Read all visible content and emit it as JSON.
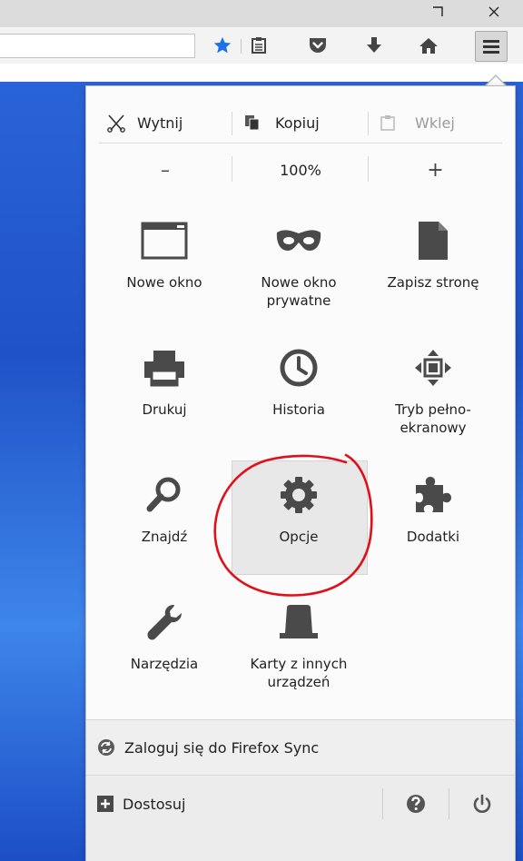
{
  "toolbar": {
    "icons": [
      "bookmark-star-icon",
      "reading-list-icon",
      "pocket-icon",
      "download-icon",
      "home-icon",
      "menu-icon"
    ],
    "accent": "#1a73e8"
  },
  "edit": {
    "cut": "Wytnij",
    "copy": "Kopiuj",
    "paste": "Wklej"
  },
  "zoom": {
    "minus": "–",
    "level": "100%",
    "plus": "+"
  },
  "grid": [
    {
      "label": "Nowe okno",
      "icon": "new-window-icon"
    },
    {
      "label": "Nowe okno prywatne",
      "icon": "private-window-icon"
    },
    {
      "label": "Zapisz stronę",
      "icon": "save-page-icon"
    },
    {
      "label": "Drukuj",
      "icon": "print-icon"
    },
    {
      "label": "Historia",
      "icon": "history-icon"
    },
    {
      "label": "Tryb pełno-ekranowy",
      "icon": "fullscreen-icon"
    },
    {
      "label": "Znajdź",
      "icon": "find-icon"
    },
    {
      "label": "Opcje",
      "icon": "options-gear-icon"
    },
    {
      "label": "Dodatki",
      "icon": "addons-icon"
    },
    {
      "label": "Narzędzia",
      "icon": "tools-wrench-icon"
    },
    {
      "label": "Karty z innych urządzeń",
      "icon": "synced-tabs-icon"
    }
  ],
  "labels": {
    "new_window": "Nowe okno",
    "private_1": "Nowe okno",
    "private_2": "prywatne",
    "save": "Zapisz stronę",
    "print": "Drukuj",
    "history": "Historia",
    "fullscreen_1": "Tryb pełno-",
    "fullscreen_2": "ekranowy",
    "find": "Znajdź",
    "options": "Opcje",
    "addons": "Dodatki",
    "tools": "Narzędzia",
    "synced_1": "Karty z innych",
    "synced_2": "urządzeń"
  },
  "sync": {
    "label": "Zaloguj się do Firefox Sync"
  },
  "footer": {
    "customize": "Dostosuj"
  }
}
